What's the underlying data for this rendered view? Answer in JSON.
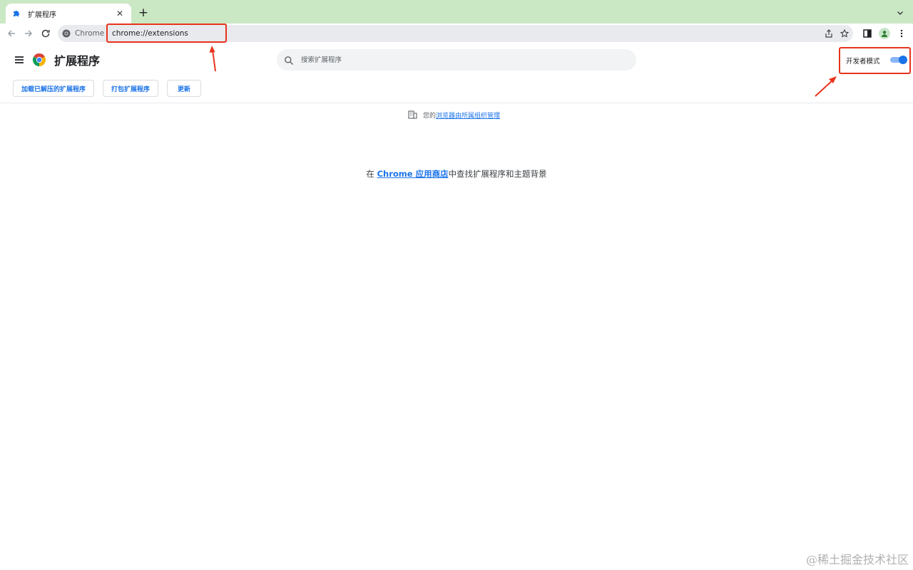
{
  "browser": {
    "tab": {
      "title": "扩展程序",
      "close_glyph": "✕",
      "icon": "puzzle-icon"
    },
    "new_tab_glyph": "+",
    "omnibox": {
      "site_label": "Chrome",
      "url": "chrome://extensions"
    }
  },
  "extensions": {
    "title": "扩展程序",
    "search_placeholder": "搜索扩展程序",
    "developer_mode": {
      "label": "开发者模式",
      "enabled": true
    },
    "actions": [
      "加载已解压的扩展程序",
      "打包扩展程序",
      "更新"
    ],
    "managed_notice": {
      "prefix": "您的",
      "link": "浏览器由所属组织管理"
    },
    "empty_state": {
      "prefix": "在 ",
      "link": "Chrome 应用商店",
      "suffix": "中查找扩展程序和主题背景"
    }
  },
  "watermark": "@稀土掘金技术社区",
  "colors": {
    "accent": "#1a73e8",
    "tabstrip": "#cbe8c4",
    "annotation": "#e8331c"
  }
}
